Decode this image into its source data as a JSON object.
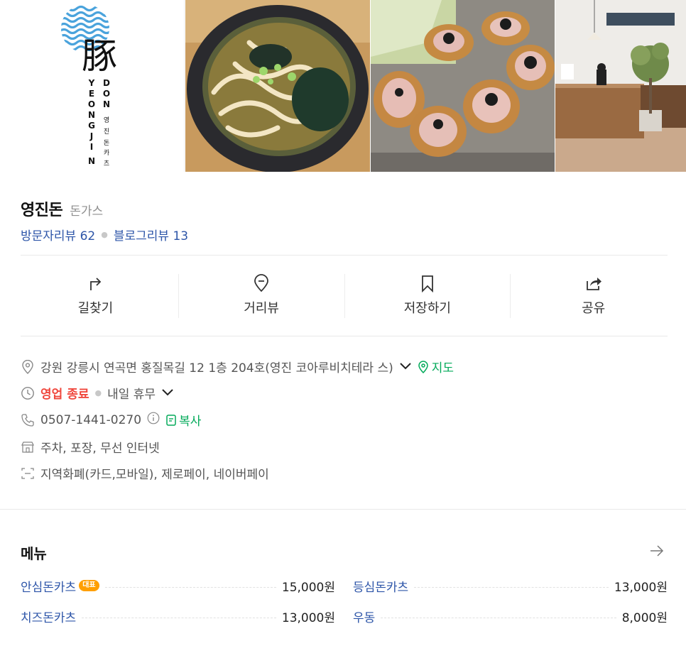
{
  "logo": {
    "char": "豚",
    "latin_left": "YEONGJIN",
    "latin_right": "DON",
    "korean_vertical": "영진돈카츠"
  },
  "photos": [
    {
      "alt": "logo"
    },
    {
      "alt": "udon bowl photo"
    },
    {
      "alt": "katsu plate photo"
    },
    {
      "alt": "restaurant interior photo"
    }
  ],
  "place": {
    "name": "영진돈",
    "category": "돈가스",
    "visitor_reviews": "방문자리뷰 62",
    "blog_reviews": "블로그리뷰 13"
  },
  "actions": [
    {
      "label": "길찾기",
      "icon": "directions-icon"
    },
    {
      "label": "거리뷰",
      "icon": "location-pin-icon"
    },
    {
      "label": "저장하기",
      "icon": "bookmark-icon"
    },
    {
      "label": "공유",
      "icon": "share-icon"
    }
  ],
  "details": {
    "address": "강원 강릉시 연곡면 홍질목길 12 1층 204호(영진 코아루비치테라 스)",
    "map_label": "지도",
    "status": "영업 종료",
    "next_status": "내일 휴무",
    "phone": "0507-1441-0270",
    "copy_label": "복사",
    "amenities": "주차, 포장, 무선 인터넷",
    "payments": "지역화폐(카드,모바일), 제로페이, 네이버페이"
  },
  "menu": {
    "title": "메뉴",
    "badge": "대표",
    "items": [
      {
        "name": "안심돈카츠",
        "price": "15,000원"
      },
      {
        "name": "등심돈카츠",
        "price": "13,000원"
      },
      {
        "name": "치즈돈카츠",
        "price": "13,000원"
      },
      {
        "name": "우동",
        "price": "8,000원"
      }
    ]
  },
  "colors": {
    "link_blue": "#2d55a8",
    "green": "#03aa5a",
    "closed_red": "#f0483e",
    "badge_orange": "#ff9f00"
  }
}
